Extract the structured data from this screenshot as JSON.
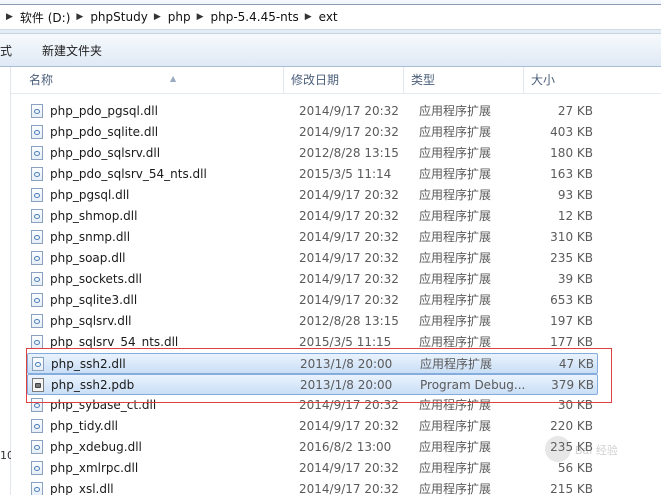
{
  "breadcrumb": [
    "软件 (D:)",
    "phpStudy",
    "php",
    "php-5.4.45-nts",
    "ext"
  ],
  "toolbar": {
    "partial_label": "式",
    "new_folder_label": "新建文件夹"
  },
  "columns": {
    "name": "名称",
    "date": "修改日期",
    "type": "类型",
    "size": "大小"
  },
  "files": [
    {
      "name": "php_pdo_pgsql.dll",
      "date": "2014/9/17 20:32",
      "type": "应用程序扩展",
      "size": "27 KB",
      "icon": "dll-icon"
    },
    {
      "name": "php_pdo_sqlite.dll",
      "date": "2014/9/17 20:32",
      "type": "应用程序扩展",
      "size": "403 KB",
      "icon": "dll-icon"
    },
    {
      "name": "php_pdo_sqlsrv.dll",
      "date": "2012/8/28 13:15",
      "type": "应用程序扩展",
      "size": "180 KB",
      "icon": "dll-icon"
    },
    {
      "name": "php_pdo_sqlsrv_54_nts.dll",
      "date": "2015/3/5 11:14",
      "type": "应用程序扩展",
      "size": "163 KB",
      "icon": "dll-icon"
    },
    {
      "name": "php_pgsql.dll",
      "date": "2014/9/17 20:32",
      "type": "应用程序扩展",
      "size": "93 KB",
      "icon": "dll-icon"
    },
    {
      "name": "php_shmop.dll",
      "date": "2014/9/17 20:32",
      "type": "应用程序扩展",
      "size": "12 KB",
      "icon": "dll-icon"
    },
    {
      "name": "php_snmp.dll",
      "date": "2014/9/17 20:32",
      "type": "应用程序扩展",
      "size": "310 KB",
      "icon": "dll-icon"
    },
    {
      "name": "php_soap.dll",
      "date": "2014/9/17 20:32",
      "type": "应用程序扩展",
      "size": "235 KB",
      "icon": "dll-icon"
    },
    {
      "name": "php_sockets.dll",
      "date": "2014/9/17 20:32",
      "type": "应用程序扩展",
      "size": "39 KB",
      "icon": "dll-icon"
    },
    {
      "name": "php_sqlite3.dll",
      "date": "2014/9/17 20:32",
      "type": "应用程序扩展",
      "size": "653 KB",
      "icon": "dll-icon"
    },
    {
      "name": "php_sqlsrv.dll",
      "date": "2012/8/28 13:15",
      "type": "应用程序扩展",
      "size": "197 KB",
      "icon": "dll-icon"
    },
    {
      "name": "php_sqlsrv_54_nts.dll",
      "date": "2015/3/5 11:15",
      "type": "应用程序扩展",
      "size": "177 KB",
      "icon": "dll-icon"
    },
    {
      "name": "php_ssh2.dll",
      "date": "2013/1/8 20:00",
      "type": "应用程序扩展",
      "size": "47 KB",
      "icon": "dll-icon",
      "selected": true
    },
    {
      "name": "php_ssh2.pdb",
      "date": "2013/1/8 20:00",
      "type": "Program Debug...",
      "size": "379 KB",
      "icon": "pdb-icon",
      "selected": true
    },
    {
      "name": "php_sybase_ct.dll",
      "date": "2014/9/17 20:32",
      "type": "应用程序扩展",
      "size": "30 KB",
      "icon": "dll-icon"
    },
    {
      "name": "php_tidy.dll",
      "date": "2014/9/17 20:32",
      "type": "应用程序扩展",
      "size": "220 KB",
      "icon": "dll-icon"
    },
    {
      "name": "php_xdebug.dll",
      "date": "2016/8/2 13:00",
      "type": "应用程序扩展",
      "size": "235 KB",
      "icon": "dll-icon"
    },
    {
      "name": "php_xmlrpc.dll",
      "date": "2014/9/17 20:32",
      "type": "应用程序扩展",
      "size": "56 KB",
      "icon": "dll-icon"
    },
    {
      "name": "php_xsl.dll",
      "date": "2014/9/17 20:32",
      "type": "应用程序扩展",
      "size": "215 KB",
      "icon": "dll-icon"
    }
  ],
  "left_pane": {
    "partial_number": "10"
  },
  "watermark": {
    "text": "Bai 经验"
  },
  "colors": {
    "selection_border": "#84acdd",
    "annotation_red": "#e04040"
  }
}
